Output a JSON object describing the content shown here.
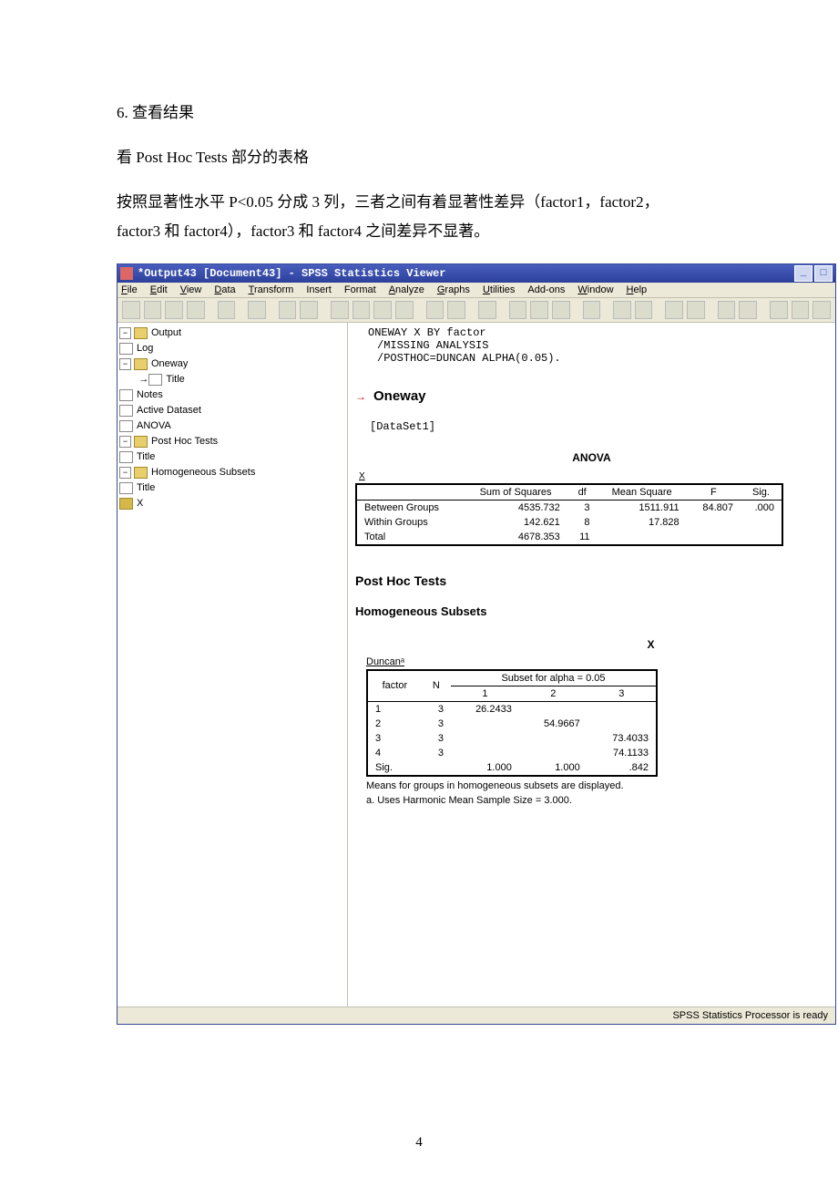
{
  "doc": {
    "heading": "6. 查看结果",
    "line1": "看 Post Hoc Tests 部分的表格",
    "line2a": "按照显著性水平 P<0.05 分成 3 列，三者之间有着显著性差异（factor1，factor2，",
    "line2b": "factor3 和 factor4），factor3 和 factor4 之间差异不显著。",
    "pagenum": "4"
  },
  "window": {
    "title": "*Output43 [Document43] - SPSS Statistics Viewer",
    "menus": [
      "File",
      "Edit",
      "View",
      "Data",
      "Transform",
      "Insert",
      "Format",
      "Analyze",
      "Graphs",
      "Utilities",
      "Add-ons",
      "Window",
      "Help"
    ],
    "statusbar": "SPSS Statistics Processor is ready"
  },
  "tree": {
    "n0": "Output",
    "n1": "Log",
    "n2": "Oneway",
    "n3": "Title",
    "n4": "Notes",
    "n5": "Active Dataset",
    "n6": "ANOVA",
    "n7": "Post Hoc Tests",
    "n8": "Title",
    "n9": "Homogeneous Subsets",
    "n10": "Title",
    "n11": "X"
  },
  "syntax": {
    "l1": "ONEWAY X BY factor",
    "l2": "/MISSING ANALYSIS",
    "l3": "/POSTHOC=DUNCAN ALPHA(0.05)."
  },
  "headings": {
    "oneway": "Oneway",
    "dataset": "[DataSet1]",
    "anova": "ANOVA",
    "x": "X",
    "posthoc": "Post Hoc Tests",
    "homosub": "Homogeneous Subsets",
    "xvar": "X",
    "duncan": "Duncanᵃ"
  },
  "anova": {
    "cols": {
      "c1": "",
      "c2": "Sum of Squares",
      "c3": "df",
      "c4": "Mean Square",
      "c5": "F",
      "c6": "Sig."
    },
    "rows": [
      {
        "lbl": "Between Groups",
        "ss": "4535.732",
        "df": "3",
        "ms": "1511.911",
        "f": "84.807",
        "sig": ".000"
      },
      {
        "lbl": "Within Groups",
        "ss": "142.621",
        "df": "8",
        "ms": "17.828",
        "f": "",
        "sig": ""
      },
      {
        "lbl": "Total",
        "ss": "4678.353",
        "df": "11",
        "ms": "",
        "f": "",
        "sig": ""
      }
    ]
  },
  "duncan": {
    "subset_label": "Subset for alpha = 0.05",
    "cols": {
      "factor": "factor",
      "n": "N",
      "s1": "1",
      "s2": "2",
      "s3": "3"
    },
    "rows": [
      {
        "f": "1",
        "n": "3",
        "s1": "26.2433",
        "s2": "",
        "s3": ""
      },
      {
        "f": "2",
        "n": "3",
        "s1": "",
        "s2": "54.9667",
        "s3": ""
      },
      {
        "f": "3",
        "n": "3",
        "s1": "",
        "s2": "",
        "s3": "73.4033"
      },
      {
        "f": "4",
        "n": "3",
        "s1": "",
        "s2": "",
        "s3": "74.1133"
      },
      {
        "f": "Sig.",
        "n": "",
        "s1": "1.000",
        "s2": "1.000",
        "s3": ".842"
      }
    ],
    "foot1": "Means for groups in homogeneous subsets are displayed.",
    "foot2": "a. Uses Harmonic Mean Sample Size = 3.000."
  }
}
